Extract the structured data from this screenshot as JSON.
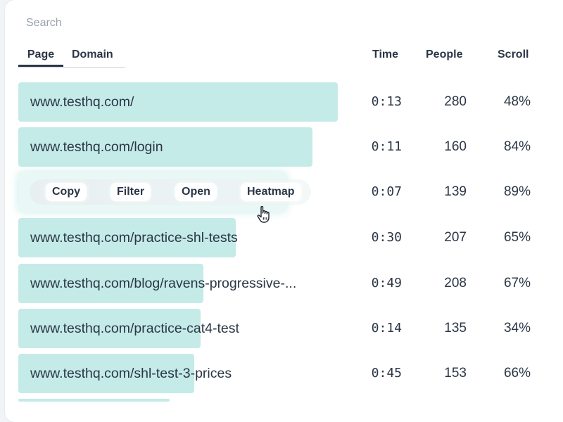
{
  "search": {
    "placeholder": "Search"
  },
  "tabs": [
    {
      "label": "Page",
      "active": true
    },
    {
      "label": "Domain",
      "active": false
    }
  ],
  "columns": {
    "time": "Time",
    "people": "People",
    "scroll": "Scroll"
  },
  "hover_actions": {
    "copy": "Copy",
    "filter": "Filter",
    "open": "Open",
    "heatmap": "Heatmap"
  },
  "rows": [
    {
      "url": "www.testhq.com/",
      "time": "0:13",
      "people": "280",
      "scroll": "48%",
      "bar_fraction": 1.0
    },
    {
      "url": "www.testhq.com/login",
      "time": "0:11",
      "people": "160",
      "scroll": "84%",
      "bar_fraction": 0.92
    },
    {
      "url": "",
      "time": "0:07",
      "people": "139",
      "scroll": "89%",
      "bar_fraction": 0.84
    },
    {
      "url": "www.testhq.com/practice-shl-tests",
      "time": "0:30",
      "people": "207",
      "scroll": "65%",
      "bar_fraction": 0.68
    },
    {
      "url": "www.testhq.com/blog/ravens-progressive-...",
      "time": "0:49",
      "people": "208",
      "scroll": "67%",
      "bar_fraction": 0.58
    },
    {
      "url": "www.testhq.com/practice-cat4-test",
      "time": "0:14",
      "people": "135",
      "scroll": "34%",
      "bar_fraction": 0.57
    },
    {
      "url": "www.testhq.com/shl-test-3-prices",
      "time": "0:45",
      "people": "153",
      "scroll": "66%",
      "bar_fraction": 0.55
    }
  ],
  "colors": {
    "bar": "#c4ebe8",
    "text": "#2b3646",
    "muted": "#9aa3b0"
  },
  "icons": {
    "cursor": "hand-pointer-icon"
  }
}
